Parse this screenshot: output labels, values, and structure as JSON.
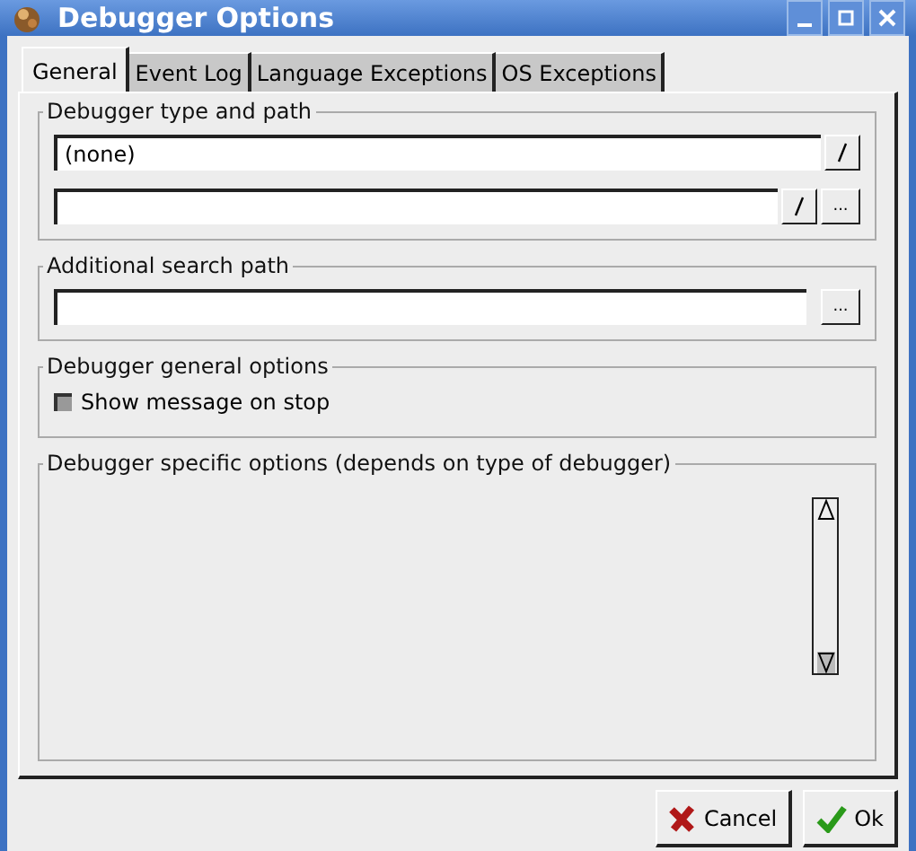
{
  "window": {
    "title": "Debugger Options"
  },
  "tabs": [
    {
      "label": "General",
      "selected": true
    },
    {
      "label": "Event Log",
      "selected": false
    },
    {
      "label": "Language Exceptions",
      "selected": false
    },
    {
      "label": "OS Exceptions",
      "selected": false
    }
  ],
  "groups": [
    {
      "kind": "paths",
      "title": "Debugger type and path",
      "debugger_type": {
        "value": "(none)"
      },
      "path_browse": "..."
    },
    {
      "kind": "search",
      "title": "Additional search path",
      "browse": "..."
    },
    {
      "kind": "options",
      "title": "Debugger general options",
      "checkbox": {
        "label": "Show message on stop",
        "checked": false
      }
    },
    {
      "kind": "specific",
      "title": "Debugger specific options (depends on type of debugger)"
    }
  ],
  "buttons": [
    {
      "kind": "cancel",
      "label": "Cancel"
    },
    {
      "kind": "ok",
      "label": "Ok"
    }
  ]
}
